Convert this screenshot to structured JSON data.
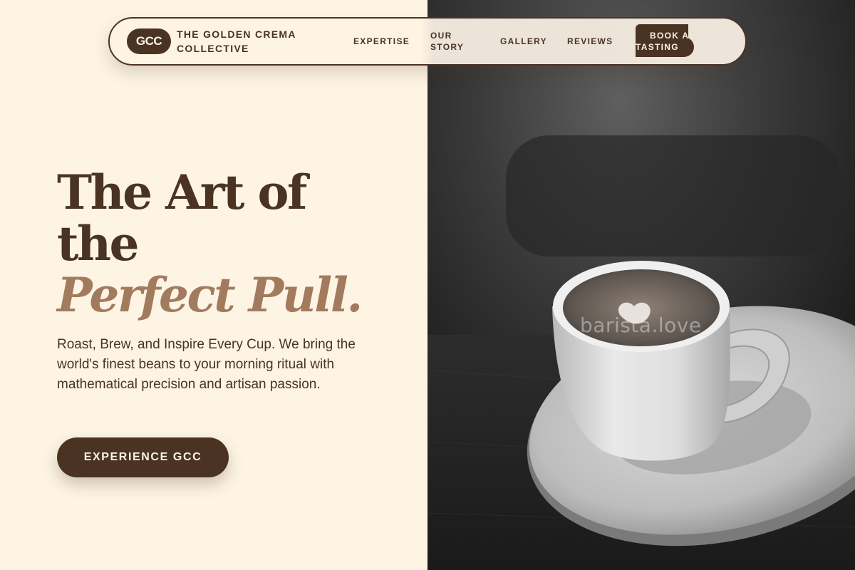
{
  "nav": {
    "logo_text": "GCC",
    "brand_name": "THE GOLDEN CREMA COLLECTIVE",
    "links": [
      "EXPERTISE",
      "OUR STORY",
      "GALLERY",
      "REVIEWS"
    ],
    "cta_line1": "BOOK A",
    "cta_line2": "TASTING"
  },
  "hero": {
    "heading_line1": "The Art of",
    "heading_line2": "the",
    "heading_accent": "Perfect Pull.",
    "subtext": "Roast, Brew, and Inspire Every Cup. We bring the world's finest beans to your morning ritual with mathematical precision and artisan passion.",
    "cta_label": "EXPERIENCE GCC"
  },
  "photo": {
    "watermark": "barista.love"
  },
  "colors": {
    "background": "#fdf4e4",
    "primary_brown": "#4a3322",
    "accent_tan": "#a27a5e"
  }
}
